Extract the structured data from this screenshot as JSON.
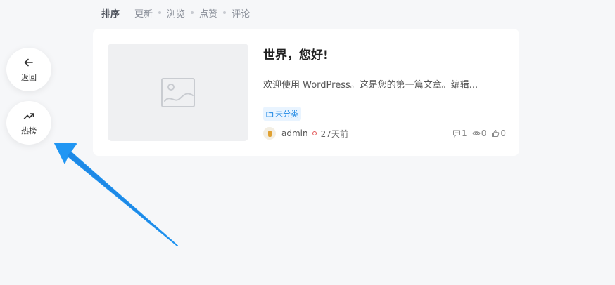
{
  "sort_bar": {
    "label": "排序",
    "options": [
      "更新",
      "浏览",
      "点赞",
      "评论"
    ]
  },
  "float_buttons": {
    "back_label": "返回",
    "hot_label": "热榜"
  },
  "post": {
    "title": "世界，您好!",
    "excerpt": "欢迎使用 WordPress。这是您的第一篇文章。编辑...",
    "category": "未分类",
    "author": "admin",
    "date": "27天前",
    "comments": "1",
    "views": "0",
    "likes": "0"
  },
  "colors": {
    "accent": "#1e88e5",
    "arrow": "#2196f3",
    "background": "#f6f7f9"
  }
}
